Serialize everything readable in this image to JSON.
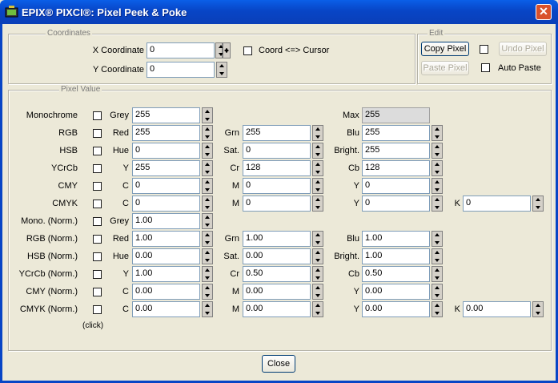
{
  "window": {
    "title": "EPIX® PIXCI®: Pixel Peek & Poke",
    "close_glyph": "✕"
  },
  "coordinates": {
    "legend": "Coordinates",
    "x_label": "X Coordinate",
    "x_value": "0",
    "y_label": "Y Coordinate",
    "y_value": "0",
    "coord_cursor_label": "Coord <=> Cursor"
  },
  "edit": {
    "legend": "Edit",
    "copy_pixel": "Copy Pixel",
    "undo_pixel": "Undo Pixel",
    "paste_pixel": "Paste Pixel",
    "auto_paste": "Auto Paste"
  },
  "pixel_value": {
    "legend": "Pixel Value",
    "click_hint": "(click)",
    "max_label": "Max",
    "max_value": "255",
    "rows": [
      {
        "name": "Monochrome",
        "c": [
          {
            "label": "Grey",
            "value": "255"
          }
        ]
      },
      {
        "name": "RGB",
        "c": [
          {
            "label": "Red",
            "value": "255"
          },
          {
            "label": "Grn",
            "value": "255"
          },
          {
            "label": "Blu",
            "value": "255"
          }
        ]
      },
      {
        "name": "HSB",
        "c": [
          {
            "label": "Hue",
            "value": "0"
          },
          {
            "label": "Sat.",
            "value": "0"
          },
          {
            "label": "Bright.",
            "value": "255"
          }
        ]
      },
      {
        "name": "YCrCb",
        "c": [
          {
            "label": "Y",
            "value": "255"
          },
          {
            "label": "Cr",
            "value": "128"
          },
          {
            "label": "Cb",
            "value": "128"
          }
        ]
      },
      {
        "name": "CMY",
        "c": [
          {
            "label": "C",
            "value": "0"
          },
          {
            "label": "M",
            "value": "0"
          },
          {
            "label": "Y",
            "value": "0"
          }
        ]
      },
      {
        "name": "CMYK",
        "c": [
          {
            "label": "C",
            "value": "0"
          },
          {
            "label": "M",
            "value": "0"
          },
          {
            "label": "Y",
            "value": "0"
          },
          {
            "label": "K",
            "value": "0"
          }
        ]
      },
      {
        "name": "Mono. (Norm.)",
        "c": [
          {
            "label": "Grey",
            "value": "1.00"
          }
        ]
      },
      {
        "name": "RGB (Norm.)",
        "c": [
          {
            "label": "Red",
            "value": "1.00"
          },
          {
            "label": "Grn",
            "value": "1.00"
          },
          {
            "label": "Blu",
            "value": "1.00"
          }
        ]
      },
      {
        "name": "HSB (Norm.)",
        "c": [
          {
            "label": "Hue",
            "value": "0.00"
          },
          {
            "label": "Sat.",
            "value": "0.00"
          },
          {
            "label": "Bright.",
            "value": "1.00"
          }
        ]
      },
      {
        "name": "YCrCb (Norm.)",
        "c": [
          {
            "label": "Y",
            "value": "1.00"
          },
          {
            "label": "Cr",
            "value": "0.50"
          },
          {
            "label": "Cb",
            "value": "0.50"
          }
        ]
      },
      {
        "name": "CMY (Norm.)",
        "c": [
          {
            "label": "C",
            "value": "0.00"
          },
          {
            "label": "M",
            "value": "0.00"
          },
          {
            "label": "Y",
            "value": "0.00"
          }
        ]
      },
      {
        "name": "CMYK (Norm.)",
        "c": [
          {
            "label": "C",
            "value": "0.00"
          },
          {
            "label": "M",
            "value": "0.00"
          },
          {
            "label": "Y",
            "value": "0.00"
          },
          {
            "label": "K",
            "value": "0.00"
          }
        ]
      }
    ]
  },
  "footer": {
    "close": "Close"
  },
  "colors": {
    "titlebar": "#0845c6",
    "dialog_bg": "#ece9d8",
    "close_button": "#d9512c"
  },
  "icons": {
    "app": "camera-app-icon",
    "close": "close-icon"
  }
}
